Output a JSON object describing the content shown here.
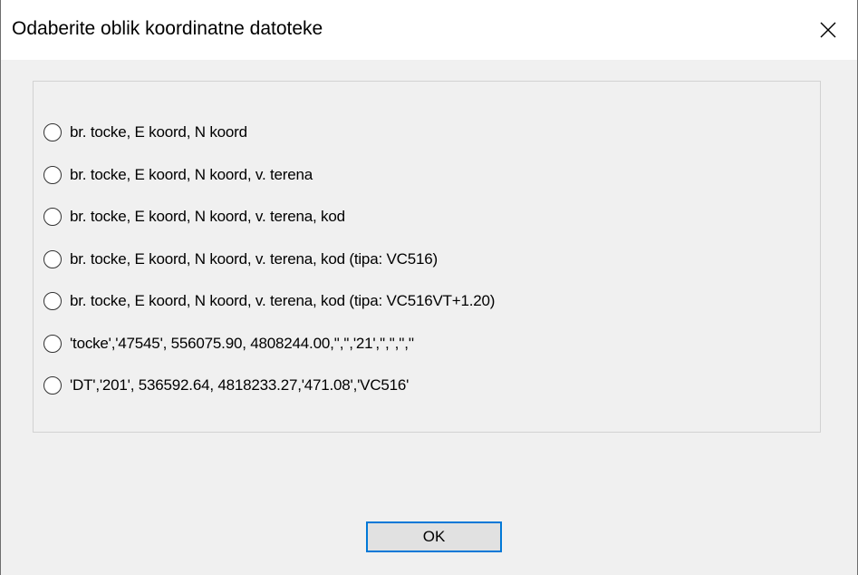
{
  "dialog": {
    "title": "Odaberite oblik koordinatne datoteke",
    "options": [
      {
        "label": "br. tocke, E koord, N koord"
      },
      {
        "label": "br. tocke, E koord, N koord, v. terena"
      },
      {
        "label": "br. tocke, E koord, N koord, v. terena, kod"
      },
      {
        "label": "br. tocke, E koord, N koord, v. terena, kod (tipa: VC516)"
      },
      {
        "label": "br. tocke, E koord, N koord, v. terena, kod (tipa: VC516VT+1.20)"
      },
      {
        "label": "'tocke','47545', 556075.90, 4808244.00,'','','21','','','',''"
      },
      {
        "label": "'DT','201', 536592.64, 4818233.27,'471.08','VC516'"
      }
    ],
    "ok_label": "OK",
    "close_icon": "close-icon"
  }
}
